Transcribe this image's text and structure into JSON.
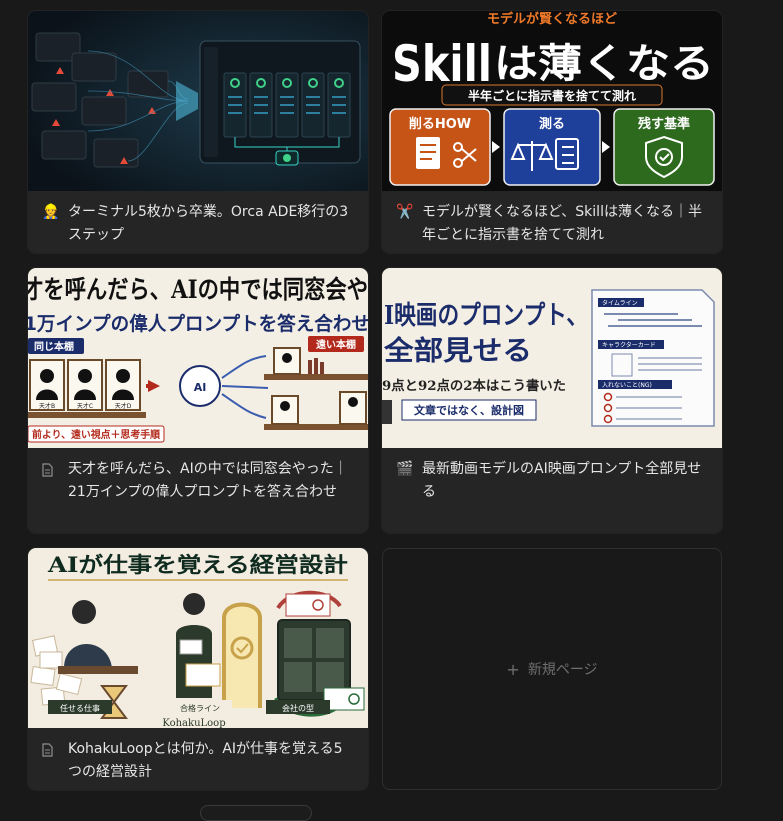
{
  "cards": [
    {
      "icon": "construction-worker-icon",
      "icon_glyph": "👷",
      "title": "ターミナル5枚から卒業。Orca ADE移行の3ステップ"
    },
    {
      "icon": "scissors-icon",
      "icon_glyph": "✂️",
      "title": "モデルが賢くなるほど、Skillは薄くなる｜半年ごとに指示書を捨てて測れ",
      "thumb": {
        "top_text": "モデルが賢くなるほど",
        "headline_a": "Skill",
        "headline_b": "は薄くなる",
        "subline": "半年ごとに指示書を捨てて測れ",
        "box1": "削るHOW",
        "box2": "測る",
        "box3": "残す基準"
      }
    },
    {
      "icon": "document-icon",
      "title": "天才を呼んだら、AIの中では同窓会やった｜21万インプの偉人プロンプトを答え合わせ",
      "thumb": {
        "line1": "才を呼んだら、AIの中では同窓会や",
        "line2": "1万インプの偉人プロンプトを答え合わせ",
        "tag_left": "同じ本棚",
        "tag_right": "遠い本棚",
        "label_a": "天才B",
        "label_b": "天才C",
        "label_c": "天才D",
        "center": "AI",
        "bottom": "前より、遠い視点＋思考手順"
      }
    },
    {
      "icon": "clapper-icon",
      "icon_glyph": "🎬",
      "title": "最新動画モデルのAI映画プロンプト全部見せる",
      "thumb": {
        "line1": "I映画のプロンプト、",
        "line2": "全部見せる",
        "line3": "9点と92点の2本はこう書いた",
        "tag": "文章ではなく、設計図",
        "doc_label1": "タイムライン",
        "doc_label2": "キャラクターカード",
        "doc_label3": "入れないこと(NG)"
      }
    },
    {
      "icon": "document-icon",
      "title": "KohakuLoopとは何か。AIが仕事を覚える5つの経営設計",
      "thumb": {
        "headline": "AIが仕事を覚える経営設計",
        "label1": "任せる仕事",
        "label2": "合格ライン",
        "label3": "会社の型",
        "brand": "KohakuLoop"
      }
    }
  ],
  "new_page": {
    "plus": "+",
    "label": "新規ページ"
  }
}
